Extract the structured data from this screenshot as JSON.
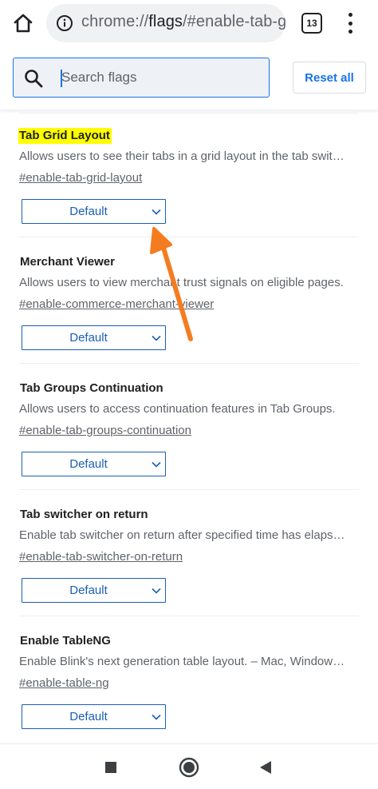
{
  "toolbar": {
    "url_prefix": "chrome://",
    "url_host": "flags",
    "url_rest": "/#enable-tab-g",
    "tab_count": "13"
  },
  "search": {
    "placeholder": "Search flags",
    "reset_label": "Reset all"
  },
  "flags": [
    {
      "title": "Tab Grid Layout",
      "description": "Allows users to see their tabs in a grid layout in the tab switcher on phones.",
      "permalink": "#enable-tab-grid-layout",
      "selected": "Default",
      "highlighted": true
    },
    {
      "title": "Merchant Viewer",
      "description": "Allows users to view merchant trust signals on eligible pages.",
      "permalink": "#enable-commerce-merchant-viewer",
      "selected": "Default",
      "highlighted": false
    },
    {
      "title": "Tab Groups Continuation",
      "description": "Allows users to access continuation features in Tab Groups.",
      "permalink": "#enable-tab-groups-continuation",
      "selected": "Default",
      "highlighted": false
    },
    {
      "title": "Tab switcher on return",
      "description": "Enable tab switcher on return after specified time has elapsed.",
      "permalink": "#enable-tab-switcher-on-return",
      "selected": "Default",
      "highlighted": false
    },
    {
      "title": "Enable TableNG",
      "description": "Enable Blink's next generation table layout. – Mac, Windows, Linux, Chrome OS, Android",
      "permalink": "#enable-table-ng",
      "selected": "Default",
      "highlighted": false
    }
  ],
  "colors": {
    "accent": "#1a73e8",
    "highlight": "#ffff00",
    "arrow": "#f47c20"
  },
  "icons": {
    "home": "home-icon",
    "info": "info-icon",
    "tabs": "tab-switcher-icon",
    "menu": "overflow-menu-icon",
    "search": "search-icon",
    "nav_recents": "recents-square-icon",
    "nav_home": "home-circle-icon",
    "nav_back": "back-triangle-icon"
  }
}
